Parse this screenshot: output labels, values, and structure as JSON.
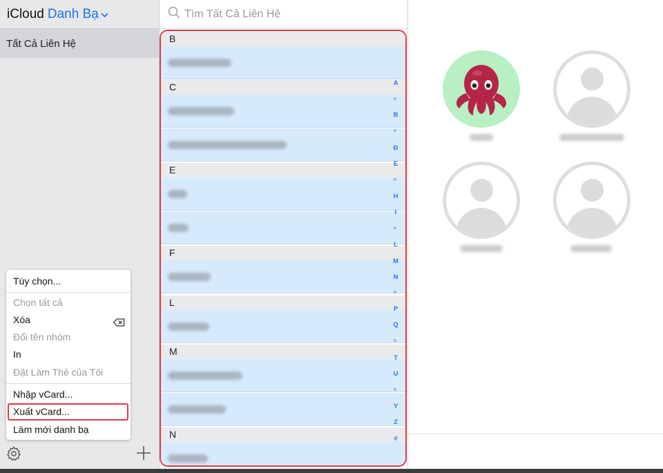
{
  "sidebar": {
    "brand": "iCloud",
    "app_name": "Danh Bạ",
    "group_all": "Tất Cả Liên Hệ"
  },
  "menu": {
    "items": [
      {
        "label": "Tùy chọn...",
        "enabled": true
      },
      {
        "label": "Chọn tất cả",
        "enabled": false
      },
      {
        "label": "Xóa",
        "enabled": true
      },
      {
        "label": "Đổi tên nhóm",
        "enabled": false
      },
      {
        "label": "In",
        "enabled": true
      },
      {
        "label": "Đặt Làm Thẻ của Tôi",
        "enabled": false
      },
      {
        "label": "Nhập vCard...",
        "enabled": true
      },
      {
        "label": "Xuất vCard...",
        "enabled": true,
        "highlighted": true
      },
      {
        "label": "Làm mới danh bạ",
        "enabled": true
      }
    ]
  },
  "search": {
    "placeholder": "Tìm Tất Cả Liên Hệ"
  },
  "list": {
    "sections": [
      "B",
      "C",
      "E",
      "F",
      "L",
      "M",
      "N"
    ]
  },
  "index_letters": [
    "A",
    "B",
    "Đ",
    "E",
    "H",
    "I",
    "L",
    "M",
    "N",
    "P",
    "Q",
    "T",
    "U",
    "Y",
    "Z",
    "#"
  ],
  "colors": {
    "accent": "#1a73e8",
    "highlight_border": "#d93a46",
    "row_bg": "#d7eafb"
  }
}
